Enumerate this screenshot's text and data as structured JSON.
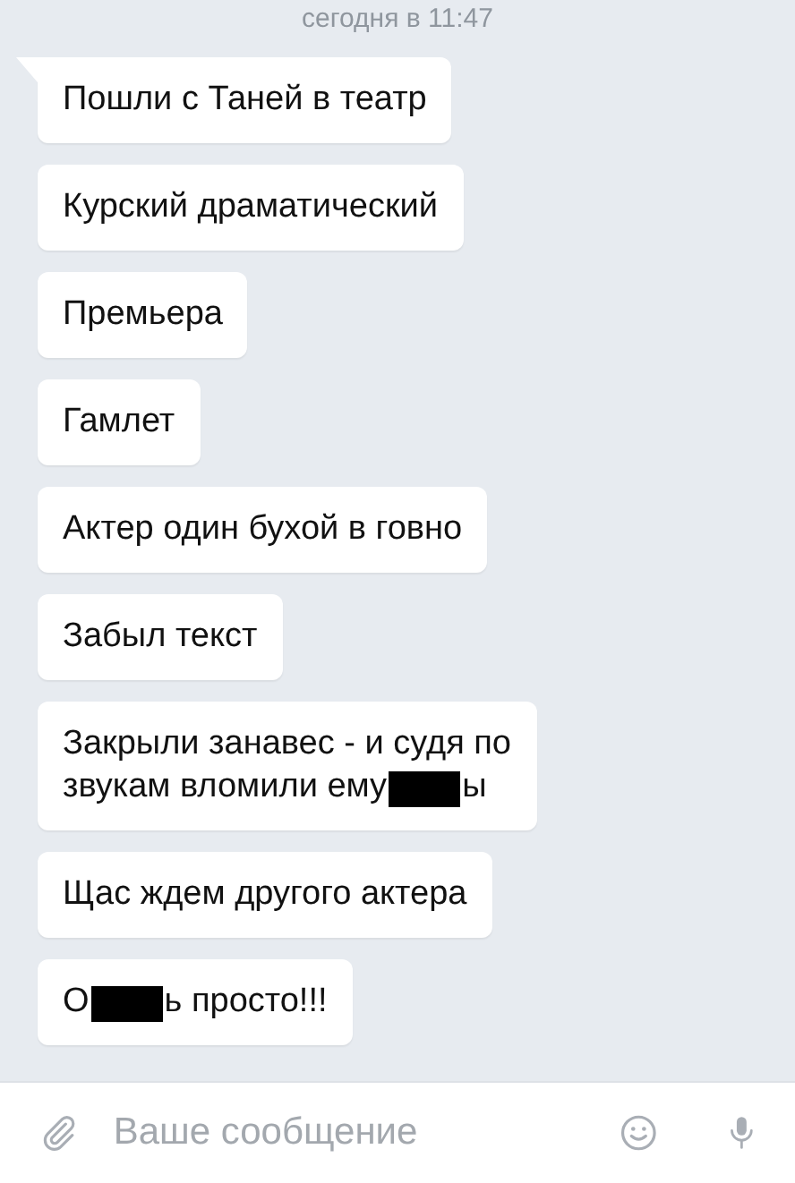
{
  "timestamp": "сегодня в 11:47",
  "messages": [
    {
      "tail": true,
      "lines": [
        [
          {
            "kind": "text",
            "text": "Пошли с Таней в театр"
          }
        ]
      ]
    },
    {
      "tail": false,
      "lines": [
        [
          {
            "kind": "text",
            "text": "Курский драматический"
          }
        ]
      ]
    },
    {
      "tail": false,
      "lines": [
        [
          {
            "kind": "text",
            "text": "Премьера"
          }
        ]
      ]
    },
    {
      "tail": false,
      "lines": [
        [
          {
            "kind": "text",
            "text": "Гамлет"
          }
        ]
      ]
    },
    {
      "tail": false,
      "lines": [
        [
          {
            "kind": "text",
            "text": "Актер один бухой в говно"
          }
        ]
      ]
    },
    {
      "tail": false,
      "lines": [
        [
          {
            "kind": "text",
            "text": "Забыл текст"
          }
        ]
      ]
    },
    {
      "tail": false,
      "lines": [
        [
          {
            "kind": "text",
            "text": "Закрыли занавес - и судя по"
          }
        ],
        [
          {
            "kind": "text",
            "text": "звукам вломили ему"
          },
          {
            "kind": "redacted"
          },
          {
            "kind": "text",
            "text": "ы"
          }
        ]
      ]
    },
    {
      "tail": false,
      "lines": [
        [
          {
            "kind": "text",
            "text": "Щас ждем другого актера"
          }
        ]
      ]
    },
    {
      "tail": false,
      "lines": [
        [
          {
            "kind": "text",
            "text": "О"
          },
          {
            "kind": "redacted"
          },
          {
            "kind": "text",
            "text": "ь просто!!!"
          }
        ]
      ]
    }
  ],
  "composer": {
    "placeholder": "Ваше сообщение"
  }
}
